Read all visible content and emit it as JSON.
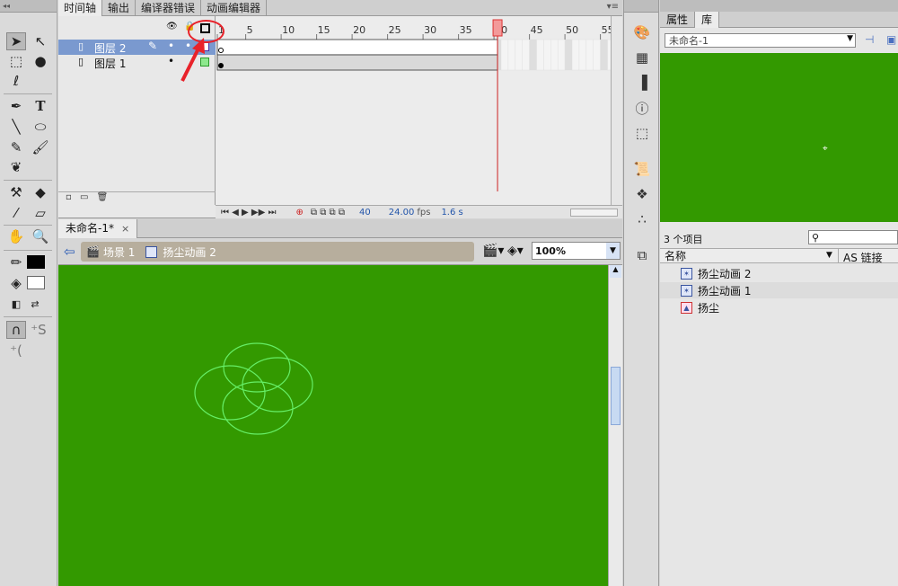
{
  "timeline": {
    "tabs": [
      "时间轴",
      "输出",
      "编译器错误",
      "动画编辑器"
    ],
    "frame_ticks": [
      "1",
      "5",
      "10",
      "15",
      "20",
      "25",
      "30",
      "35",
      "40",
      "45",
      "50",
      "55"
    ],
    "layers": [
      {
        "name": "图层 2",
        "selected": true
      },
      {
        "name": "图层 1",
        "selected": false
      }
    ],
    "status": {
      "frame": "40",
      "fps": "24.00",
      "fps_unit": "fps",
      "time": "1.6 s"
    },
    "playhead_frame": 40
  },
  "document": {
    "tab": "未命名-1*",
    "close": "×"
  },
  "editbar": {
    "scene": "场景 1",
    "symbol": "扬尘动画 2",
    "zoom": "100%"
  },
  "library": {
    "tabs": [
      "属性",
      "库"
    ],
    "doc_select": "未命名-1",
    "count": "3 个项目",
    "search_placeholder": "",
    "col_name": "名称",
    "col_link": "AS 链接",
    "items": [
      {
        "name": "扬尘动画 2"
      },
      {
        "name": "扬尘动画 1"
      },
      {
        "name": "扬尘"
      }
    ]
  },
  "colors": {
    "stage": "#339900",
    "layer_selected": "#7a99cf",
    "annotation": "#e8222a",
    "outline": "#66ee66"
  }
}
